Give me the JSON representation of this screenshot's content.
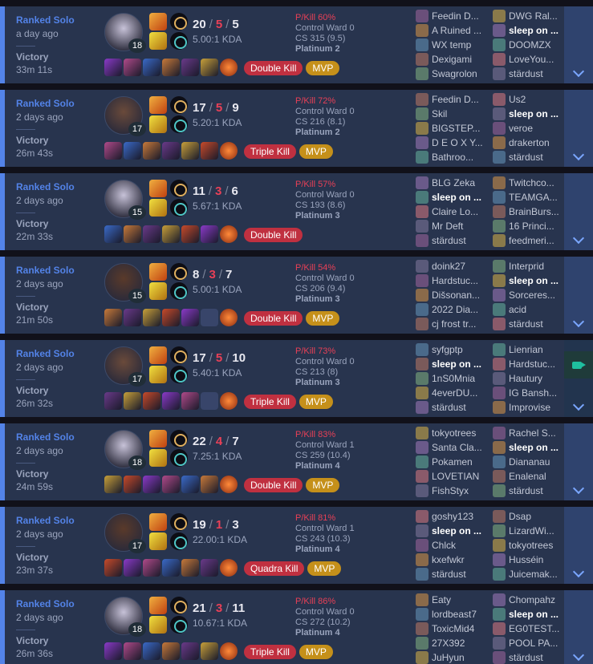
{
  "colors": {
    "win_accent": "#5383e8",
    "win_bg": "#28344e",
    "deaths": "#e84057",
    "mvp": "#c5901a",
    "multikill": "#c03040"
  },
  "matches": [
    {
      "queue": "Ranked Solo",
      "when": "a day ago",
      "result": "Victory",
      "duration": "33m 11s",
      "level": "18",
      "kills": "20",
      "deaths": "5",
      "assists": "5",
      "kda": "5.00:1 KDA",
      "pkill": "P/Kill 60%",
      "control_ward": "Control Ward 0",
      "cs": "CS 315 (9.5)",
      "tier": "Platinum 2",
      "multikill": "Double Kill",
      "mvp": "MVP",
      "team1": [
        "Feedin D...",
        "A Ruined ...",
        "WX temp",
        "Dexigami",
        "Swagrolon"
      ],
      "team2": [
        "DWG Ral...",
        "sleep on ...",
        "DOOMZX",
        "LoveYou...",
        "stärdust"
      ],
      "me_team": 2,
      "me_index": 1,
      "recorded": false
    },
    {
      "queue": "Ranked Solo",
      "when": "2 days ago",
      "result": "Victory",
      "duration": "26m 43s",
      "level": "17",
      "kills": "17",
      "deaths": "5",
      "assists": "9",
      "kda": "5.20:1 KDA",
      "pkill": "P/Kill 72%",
      "control_ward": "Control Ward 0",
      "cs": "CS 216 (8.1)",
      "tier": "Platinum 2",
      "multikill": "Triple Kill",
      "mvp": "MVP",
      "team1": [
        "Feedin D...",
        "Skil",
        "BIGSTEP...",
        "D E O X Y...",
        "Bathroo..."
      ],
      "team2": [
        "Us2",
        "sleep on ...",
        "veroe",
        "drakerton",
        "stärdust"
      ],
      "me_team": 2,
      "me_index": 1,
      "recorded": false
    },
    {
      "queue": "Ranked Solo",
      "when": "2 days ago",
      "result": "Victory",
      "duration": "22m 33s",
      "level": "15",
      "kills": "11",
      "deaths": "3",
      "assists": "6",
      "kda": "5.67:1 KDA",
      "pkill": "P/Kill 57%",
      "control_ward": "Control Ward 0",
      "cs": "CS 193 (8.6)",
      "tier": "Platinum 3",
      "multikill": "Double Kill",
      "mvp": "",
      "team1": [
        "BLG Zeka",
        "sleep on ...",
        "Claire Lo...",
        "Mr Deft",
        "stärdust"
      ],
      "team2": [
        "Twitchco...",
        "TEAMGA...",
        "BrainBurs...",
        "16 Princi...",
        "feedmeri..."
      ],
      "me_team": 1,
      "me_index": 1,
      "recorded": false
    },
    {
      "queue": "Ranked Solo",
      "when": "2 days ago",
      "result": "Victory",
      "duration": "21m 50s",
      "level": "15",
      "kills": "8",
      "deaths": "3",
      "assists": "7",
      "kda": "5.00:1 KDA",
      "pkill": "P/Kill 54%",
      "control_ward": "Control Ward 0",
      "cs": "CS 206 (9.4)",
      "tier": "Platinum 3",
      "multikill": "Double Kill",
      "mvp": "MVP",
      "team1": [
        "doink27",
        "Hardstuc...",
        "Dišsonan...",
        "2022 Dia...",
        "cj frost tr..."
      ],
      "team2": [
        "Interprid",
        "sleep on ...",
        "Sorceres...",
        "acid",
        "stärdust"
      ],
      "me_team": 2,
      "me_index": 1,
      "recorded": false
    },
    {
      "queue": "Ranked Solo",
      "when": "2 days ago",
      "result": "Victory",
      "duration": "26m 32s",
      "level": "17",
      "kills": "17",
      "deaths": "5",
      "assists": "10",
      "kda": "5.40:1 KDA",
      "pkill": "P/Kill 73%",
      "control_ward": "Control Ward 0",
      "cs": "CS 213 (8)",
      "tier": "Platinum 3",
      "multikill": "Triple Kill",
      "mvp": "MVP",
      "team1": [
        "syfgptp",
        "sleep on ...",
        "1nS0Mnia",
        "4everDU...",
        "stärdust"
      ],
      "team2": [
        "Lienrian",
        "Hardstuc...",
        "Hautury",
        "IG Bansh...",
        "Improvise"
      ],
      "me_team": 1,
      "me_index": 1,
      "recorded": true
    },
    {
      "queue": "Ranked Solo",
      "when": "2 days ago",
      "result": "Victory",
      "duration": "24m 59s",
      "level": "18",
      "kills": "22",
      "deaths": "4",
      "assists": "7",
      "kda": "7.25:1 KDA",
      "pkill": "P/Kill 83%",
      "control_ward": "Control Ward 1",
      "cs": "CS 259 (10.4)",
      "tier": "Platinum 4",
      "multikill": "Double Kill",
      "mvp": "MVP",
      "team1": [
        "tokyotrees",
        "Santa Cla...",
        "Pokamen",
        "LOVETIAN",
        "FishStyx"
      ],
      "team2": [
        "Rachel S...",
        "sleep on ...",
        "Diananau",
        "Enalenal",
        "stärdust"
      ],
      "me_team": 2,
      "me_index": 1,
      "recorded": false
    },
    {
      "queue": "Ranked Solo",
      "when": "2 days ago",
      "result": "Victory",
      "duration": "23m 37s",
      "level": "17",
      "kills": "19",
      "deaths": "1",
      "assists": "3",
      "kda": "22.00:1 KDA",
      "pkill": "P/Kill 81%",
      "control_ward": "Control Ward 1",
      "cs": "CS 243 (10.3)",
      "tier": "Platinum 4",
      "multikill": "Quadra Kill",
      "mvp": "MVP",
      "team1": [
        "goshy123",
        "sleep on ...",
        "Chlck",
        "kxefwkr",
        "stärdust"
      ],
      "team2": [
        "Dsap",
        "LizardWi...",
        "tokyotrees",
        "Husséin",
        "Juicemak..."
      ],
      "me_team": 1,
      "me_index": 1,
      "recorded": false
    },
    {
      "queue": "Ranked Solo",
      "when": "2 days ago",
      "result": "Victory",
      "duration": "26m 36s",
      "level": "18",
      "kills": "21",
      "deaths": "3",
      "assists": "11",
      "kda": "10.67:1 KDA",
      "pkill": "P/Kill 86%",
      "control_ward": "Control Ward 0",
      "cs": "CS 272 (10.2)",
      "tier": "Platinum 4",
      "multikill": "Triple Kill",
      "mvp": "MVP",
      "team1": [
        "Eaty",
        "lordbeast7",
        "ToxicMid4",
        "27X392",
        "JuHyun"
      ],
      "team2": [
        "Chompahz",
        "sleep on ...",
        "EG0TEST...",
        "POOL PA...",
        "stärdust"
      ],
      "me_team": 2,
      "me_index": 1,
      "recorded": false
    }
  ]
}
